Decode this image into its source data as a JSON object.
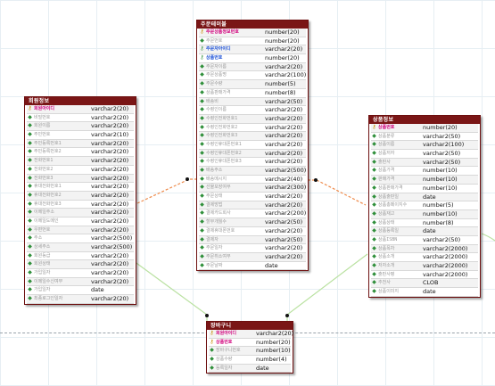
{
  "tables": {
    "member": {
      "title": "회원정보",
      "columns": [
        {
          "name": "회원아이디",
          "type": "varchar2(20)",
          "key": "pk"
        },
        {
          "name": "비밀번호",
          "type": "varchar2(20)",
          "key": ""
        },
        {
          "name": "회원이름",
          "type": "varchar2(20)",
          "key": ""
        },
        {
          "name": "주민번호",
          "type": "varchar2(10)",
          "key": ""
        },
        {
          "name": "주민등록번호1",
          "type": "varchar2(20)",
          "key": ""
        },
        {
          "name": "주민등록번호2",
          "type": "varchar2(20)",
          "key": ""
        },
        {
          "name": "전화번호1",
          "type": "varchar2(20)",
          "key": ""
        },
        {
          "name": "전화번호2",
          "type": "varchar2(20)",
          "key": ""
        },
        {
          "name": "전화번호3",
          "type": "varchar2(20)",
          "key": ""
        },
        {
          "name": "휴대전화번호1",
          "type": "varchar2(20)",
          "key": ""
        },
        {
          "name": "휴대전화번호2",
          "type": "varchar2(20)",
          "key": ""
        },
        {
          "name": "휴대전화번호3",
          "type": "varchar2(20)",
          "key": ""
        },
        {
          "name": "이메일주소",
          "type": "varchar2(20)",
          "key": ""
        },
        {
          "name": "이메일도메인",
          "type": "varchar2(20)",
          "key": ""
        },
        {
          "name": "우편번호",
          "type": "varchar2(20)",
          "key": ""
        },
        {
          "name": "주소",
          "type": "varchar2(500)",
          "key": ""
        },
        {
          "name": "상세주소",
          "type": "varchar2(500)",
          "key": ""
        },
        {
          "name": "회원등급",
          "type": "varchar2(20)",
          "key": ""
        },
        {
          "name": "회원상태",
          "type": "varchar2(20)",
          "key": ""
        },
        {
          "name": "가입일자",
          "type": "varchar2(20)",
          "key": ""
        },
        {
          "name": "이메일수신여부",
          "type": "varchar2(20)",
          "key": ""
        },
        {
          "name": "가입일자",
          "type": "date",
          "key": ""
        },
        {
          "name": "최종로그인일자",
          "type": "varchar2(20)",
          "key": ""
        }
      ]
    },
    "order": {
      "title": "주문테이블",
      "columns": [
        {
          "name": "주문상품정보번호",
          "type": "number(20)",
          "key": "pk"
        },
        {
          "name": "주문번호",
          "type": "number(20)",
          "key": ""
        },
        {
          "name": "주문자아이디",
          "type": "varchar2(20)",
          "key": "fk"
        },
        {
          "name": "상품번호",
          "type": "number(20)",
          "key": "fk"
        },
        {
          "name": "주문자이름",
          "type": "varchar2(20)",
          "key": ""
        },
        {
          "name": "주문상품명",
          "type": "varchar2(100)",
          "key": ""
        },
        {
          "name": "주문수량",
          "type": "number(5)",
          "key": ""
        },
        {
          "name": "상품판매가격",
          "type": "number(8)",
          "key": ""
        },
        {
          "name": "배송비",
          "type": "varchar2(50)",
          "key": ""
        },
        {
          "name": "수령인이름",
          "type": "varchar2(20)",
          "key": ""
        },
        {
          "name": "수령인전화번호1",
          "type": "varchar2(20)",
          "key": ""
        },
        {
          "name": "수령인전화번호2",
          "type": "varchar2(20)",
          "key": ""
        },
        {
          "name": "수령인전화번호3",
          "type": "varchar2(20)",
          "key": ""
        },
        {
          "name": "수령인휴대폰번호1",
          "type": "varchar2(20)",
          "key": ""
        },
        {
          "name": "수령인휴대폰번호2",
          "type": "varchar2(20)",
          "key": ""
        },
        {
          "name": "수령인휴대폰번호3",
          "type": "varchar2(20)",
          "key": ""
        },
        {
          "name": "배송주소",
          "type": "varchar2(500)",
          "key": ""
        },
        {
          "name": "배송메시지",
          "type": "varchar2(40)",
          "key": ""
        },
        {
          "name": "선물포장여부",
          "type": "varchar2(300)",
          "key": ""
        },
        {
          "name": "주문상태",
          "type": "varchar2(20)",
          "key": ""
        },
        {
          "name": "결제방법",
          "type": "varchar2(20)",
          "key": ""
        },
        {
          "name": "결제카드회사",
          "type": "varchar2(200)",
          "key": ""
        },
        {
          "name": "할부개월수",
          "type": "varchar2(50)",
          "key": ""
        },
        {
          "name": "결제휴대폰번호",
          "type": "varchar2(20)",
          "key": ""
        },
        {
          "name": "결제자",
          "type": "varchar2(50)",
          "key": ""
        },
        {
          "name": "주문일자",
          "type": "varchar2(20)",
          "key": ""
        },
        {
          "name": "주문취소여부",
          "type": "varchar2(20)",
          "key": ""
        },
        {
          "name": "주문날짜",
          "type": "date",
          "key": ""
        }
      ]
    },
    "product": {
      "title": "상품정보",
      "columns": [
        {
          "name": "상품번호",
          "type": "number(20)",
          "key": "pk"
        },
        {
          "name": "상품분류",
          "type": "varchar2(50)",
          "key": ""
        },
        {
          "name": "상품이름",
          "type": "varchar2(100)",
          "key": ""
        },
        {
          "name": "상품저자",
          "type": "varchar2(50)",
          "key": ""
        },
        {
          "name": "출판사",
          "type": "varchar2(50)",
          "key": ""
        },
        {
          "name": "상품가격",
          "type": "number(10)",
          "key": ""
        },
        {
          "name": "판매가격",
          "type": "number(10)",
          "key": ""
        },
        {
          "name": "상품판매가격",
          "type": "number(10)",
          "key": ""
        },
        {
          "name": "상품출판일",
          "type": "date",
          "key": ""
        },
        {
          "name": "상품총페이지수",
          "type": "number(5)",
          "key": ""
        },
        {
          "name": "상품재고",
          "type": "number(10)",
          "key": ""
        },
        {
          "name": "상품상태",
          "type": "number(8)",
          "key": ""
        },
        {
          "name": "상품등록일",
          "type": "date",
          "key": ""
        },
        {
          "name": "상품ISBN",
          "type": "varchar2(50)",
          "key": ""
        },
        {
          "name": "상품목차",
          "type": "varchar2(2000)",
          "key": ""
        },
        {
          "name": "상품소개",
          "type": "varchar2(2000)",
          "key": ""
        },
        {
          "name": "저자소개",
          "type": "varchar2(2000)",
          "key": ""
        },
        {
          "name": "출판사평",
          "type": "varchar2(2000)",
          "key": ""
        },
        {
          "name": "추천사",
          "type": "CLOB",
          "key": ""
        },
        {
          "name": "상품이미지",
          "type": "date",
          "key": ""
        }
      ]
    },
    "cart": {
      "title": "장바구니",
      "columns": [
        {
          "name": "회원아이디",
          "type": "varchar2(20)",
          "key": "pk"
        },
        {
          "name": "상품번호",
          "type": "number(20)",
          "key": "pk"
        },
        {
          "name": "장바구니번호",
          "type": "number(10)",
          "key": ""
        },
        {
          "name": "상품수량",
          "type": "number(4)",
          "key": ""
        },
        {
          "name": "등록일자",
          "type": "date",
          "key": ""
        }
      ]
    }
  }
}
